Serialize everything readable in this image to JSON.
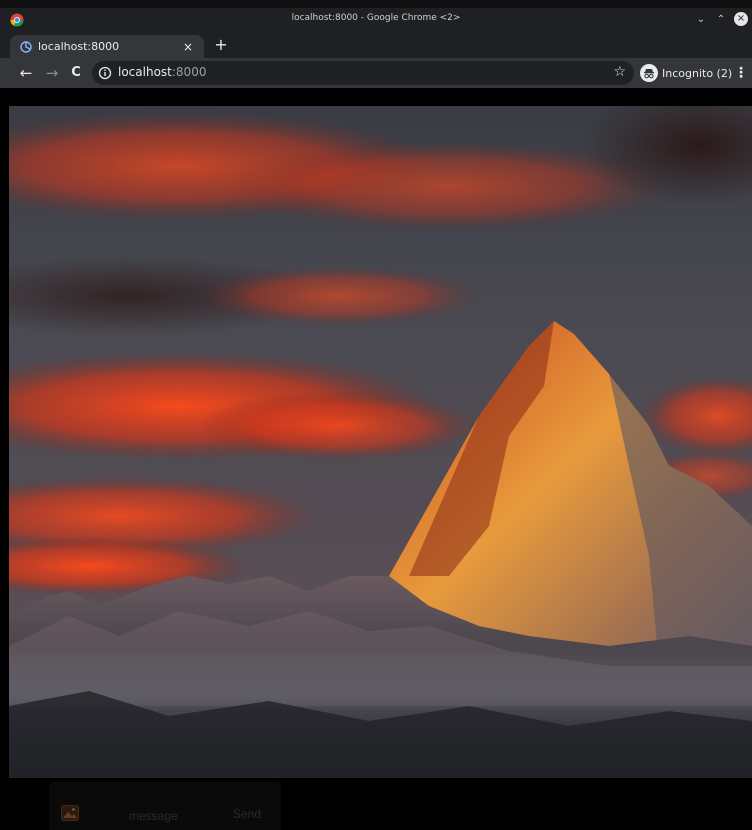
{
  "window": {
    "title": "localhost:8000 - Google Chrome <2>",
    "controls": {
      "minimize": "⌄",
      "maximize": "⌃",
      "close": "×"
    }
  },
  "tabs": [
    {
      "label": "localhost:8000",
      "active": true,
      "close_glyph": "×"
    }
  ],
  "tabstrip": {
    "new_tab_glyph": "+"
  },
  "toolbar": {
    "back_glyph": "←",
    "forward_glyph": "→",
    "reload_glyph": "C",
    "url_host": "localhost",
    "url_port": ":8000",
    "star_glyph": "☆",
    "incognito_label": "Incognito (2)",
    "menu_glyph": "⋮"
  },
  "page": {
    "hero_image": "mountain-sunset-image",
    "composer": {
      "placeholder": "message",
      "send_label": "Send",
      "attach_icon": "image-icon"
    }
  },
  "colors": {
    "chrome_dark": "#1f2023",
    "toolbar": "#35363a",
    "omnibox": "#202124",
    "page_bg": "#000000",
    "sky_red": "#e0431c"
  }
}
